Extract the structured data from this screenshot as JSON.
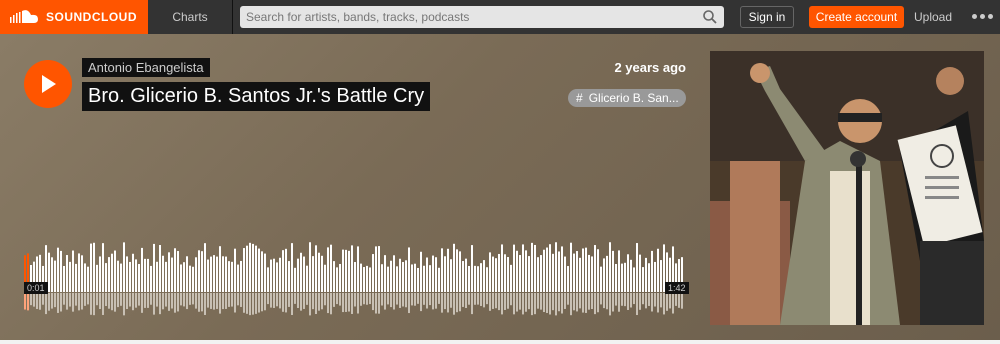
{
  "header": {
    "logo_text": "SOUNDCLOUD",
    "nav_charts": "Charts",
    "search_placeholder": "Search for artists, bands, tracks, podcasts",
    "signin": "Sign in",
    "create_account": "Create account",
    "upload": "Upload"
  },
  "track": {
    "artist": "Antonio Ebangelista",
    "title": "Bro. Glicerio B. Santos Jr.'s Battle Cry",
    "posted": "2 years ago",
    "tag": "Glicerio B. San...",
    "time_current": "0:01",
    "time_total": "1:42",
    "progress_fraction": 0.01
  },
  "colors": {
    "accent": "#ff5500",
    "topbar": "#333333"
  }
}
